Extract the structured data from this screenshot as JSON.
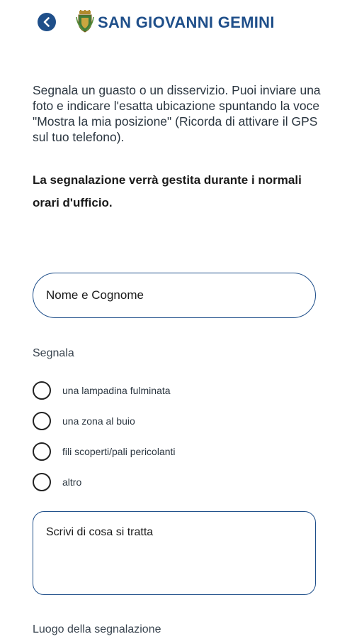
{
  "header": {
    "title": "SAN GIOVANNI GEMINI",
    "back_icon": "chevron-left-icon",
    "logo_icon": "coat-of-arms-icon",
    "accent_color": "#1f4f8a"
  },
  "intro": {
    "text": "Segnala un guasto o un disservizio. Puoi inviare una foto e indicare l'esatta ubicazione spuntando la voce \"Mostra la mia posizione\" (Ricorda di attivare il GPS sul tuo telefono).",
    "notice": "La segnalazione verrà gestita durante i normali orari d'ufficio."
  },
  "form": {
    "name_placeholder": "Nome e Cognome",
    "segnala_label": "Segnala",
    "options": [
      {
        "label": "una lampadina fulminata"
      },
      {
        "label": "una zona al buio"
      },
      {
        "label": "fili scoperti/pali pericolanti"
      },
      {
        "label": "altro"
      }
    ],
    "description_placeholder": "Scrivi di cosa si tratta",
    "location_label": "Luogo della segnalazione"
  }
}
